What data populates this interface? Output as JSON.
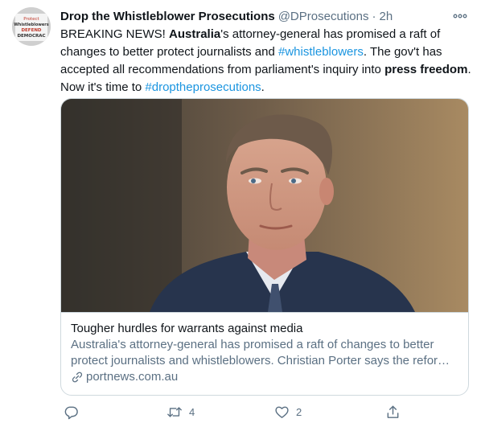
{
  "author": {
    "name": "Drop the Whistleblower Prosecutions",
    "handle": "@DProsecutions",
    "separator": "·",
    "time": "2h",
    "avatar_text": [
      "Protect",
      "Whistleblowers",
      "DEFEND",
      "DEMOCRAC"
    ]
  },
  "tweet": {
    "segments": [
      {
        "text": "BREAKING NEWS! ",
        "style": "plain"
      },
      {
        "text": "Australia",
        "style": "bold"
      },
      {
        "text": "'s attorney-general has promised a raft of changes to better protect journalists and ",
        "style": "plain"
      },
      {
        "text": "#whistleblowers",
        "style": "tag"
      },
      {
        "text": ". The gov't has accepted all recommendations from parliament's inquiry into ",
        "style": "plain"
      },
      {
        "text": "press freedom",
        "style": "bold"
      },
      {
        "text": ". Now it's time to ",
        "style": "plain"
      },
      {
        "text": "#droptheprosecutions",
        "style": "tag"
      },
      {
        "text": ".",
        "style": "plain"
      }
    ]
  },
  "card": {
    "title": "Tougher hurdles for warrants against media",
    "description": "Australia's attorney-general has promised a raft of changes to better protect journalists and whistleblowers. Christian Porter says the reforms ...",
    "domain": "portnews.com.au"
  },
  "actions": {
    "reply_count": "",
    "retweet_count": "4",
    "like_count": "2"
  },
  "colors": {
    "link": "#1b95e0",
    "secondary_text": "#5b7083",
    "border": "#cfd9de"
  },
  "icons": [
    "more-icon",
    "link-icon",
    "reply-icon",
    "retweet-icon",
    "like-icon",
    "share-icon"
  ]
}
